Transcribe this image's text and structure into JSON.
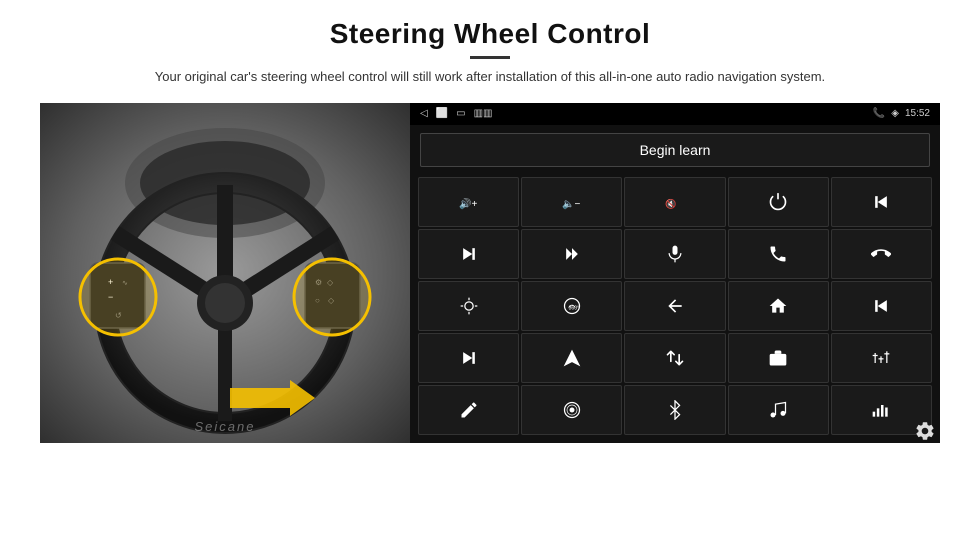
{
  "header": {
    "title": "Steering Wheel Control",
    "subtitle": "Your original car's steering wheel control will still work after installation of this all-in-one auto radio navigation system."
  },
  "statusBar": {
    "time": "15:52",
    "icons": [
      "back",
      "home",
      "recents",
      "signal"
    ]
  },
  "beginLearn": {
    "label": "Begin learn"
  },
  "controls": [
    {
      "icon": "vol-up",
      "unicode": "🔊+"
    },
    {
      "icon": "vol-down",
      "unicode": "🔈−"
    },
    {
      "icon": "mute",
      "unicode": "🔇"
    },
    {
      "icon": "power",
      "unicode": "⏻"
    },
    {
      "icon": "prev-track",
      "unicode": "⏮"
    },
    {
      "icon": "next",
      "unicode": "⏭"
    },
    {
      "icon": "fast-forward",
      "unicode": "⏩"
    },
    {
      "icon": "mic",
      "unicode": "🎙"
    },
    {
      "icon": "phone",
      "unicode": "📞"
    },
    {
      "icon": "hang-up",
      "unicode": "📵"
    },
    {
      "icon": "brightness",
      "unicode": "💡"
    },
    {
      "icon": "360",
      "unicode": "360"
    },
    {
      "icon": "back-nav",
      "unicode": "↩"
    },
    {
      "icon": "home-nav",
      "unicode": "🏠"
    },
    {
      "icon": "skip-back",
      "unicode": "⏮"
    },
    {
      "icon": "skip-fwd",
      "unicode": "⏭"
    },
    {
      "icon": "nav",
      "unicode": "➤"
    },
    {
      "icon": "swap",
      "unicode": "⇄"
    },
    {
      "icon": "camera",
      "unicode": "📷"
    },
    {
      "icon": "eq",
      "unicode": "🎛"
    },
    {
      "icon": "pen",
      "unicode": "✏"
    },
    {
      "icon": "radio",
      "unicode": "⏺"
    },
    {
      "icon": "bluetooth",
      "unicode": "⚡"
    },
    {
      "icon": "music",
      "unicode": "♫"
    },
    {
      "icon": "spectrum",
      "unicode": "📶"
    }
  ],
  "watermark": "Seicane",
  "colors": {
    "background": "#111111",
    "button_bg": "#1a1a1a",
    "button_border": "#333333",
    "status_bar": "#000000",
    "text": "#ffffff",
    "yellow": "#f5c000"
  }
}
